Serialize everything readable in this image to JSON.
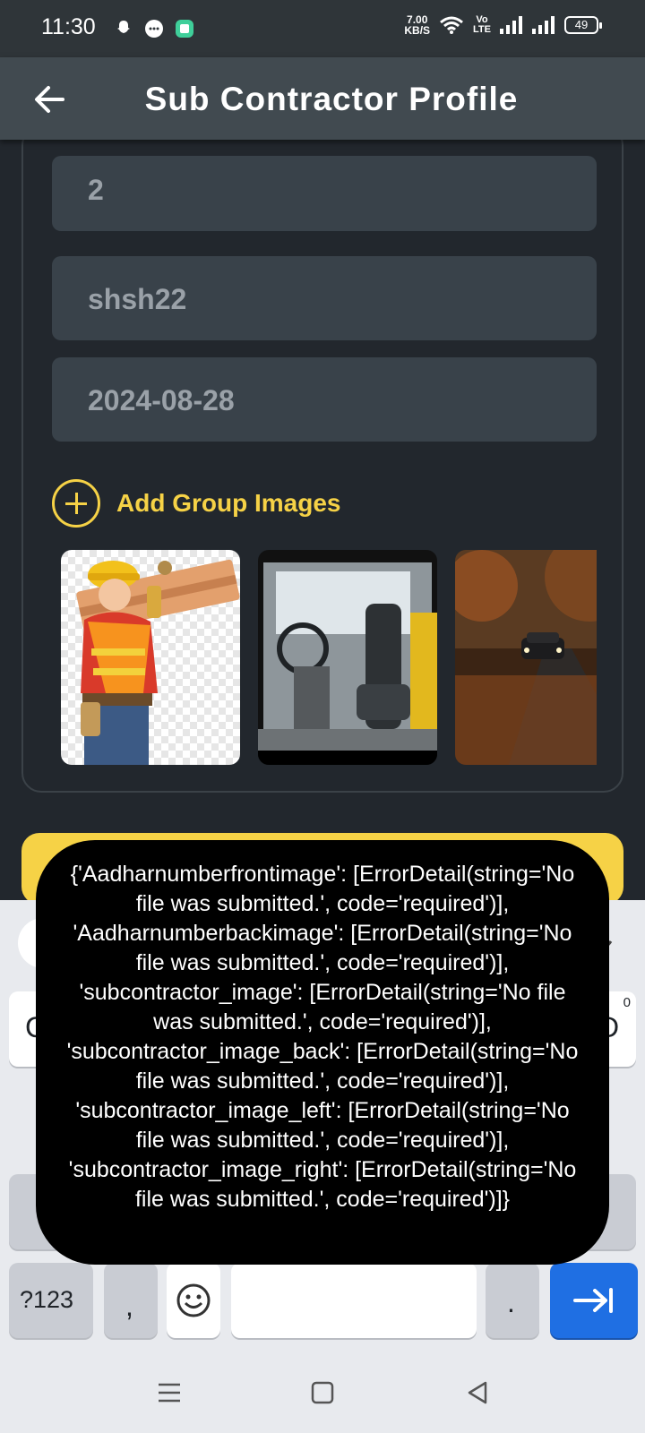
{
  "status_bar": {
    "time": "11:30",
    "net_speed_value": "7.00",
    "net_speed_unit": "KB/S",
    "volte_line1": "Vo",
    "volte_line2": "LTE",
    "battery": "49"
  },
  "app_bar": {
    "title": "Sub Contractor Profile"
  },
  "form": {
    "fields": [
      {
        "value": "2"
      },
      {
        "value": "shsh22"
      },
      {
        "value": "2024-08-28"
      }
    ],
    "add_images_label": "Add Group Images"
  },
  "keyboard": {
    "key_q_partial": "C",
    "key_p_partial": "D",
    "key_p_hint": "0",
    "symbols_label": "?123",
    "comma_label": ",",
    "period_label": "."
  },
  "toast": {
    "message": "{'Aadharnumberfrontimage': [ErrorDetail(string='No file was submitted.', code='required')], 'Aadharnumberbackimage': [ErrorDetail(string='No file was submitted.', code='required')], 'subcontractor_image': [ErrorDetail(string='No file was submitted.', code='required')], 'subcontractor_image_back': [ErrorDetail(string='No file was submitted.', code='required')], 'subcontractor_image_left': [ErrorDetail(string='No file was submitted.', code='required')], 'subcontractor_image_right': [ErrorDetail(string='No file was submitted.', code='required')]}"
  },
  "colors": {
    "accent_yellow": "#f6d246",
    "background": "#22272d",
    "app_bar": "#414a50",
    "field": "#39424a",
    "keyboard_action_blue": "#1f6fe3"
  }
}
